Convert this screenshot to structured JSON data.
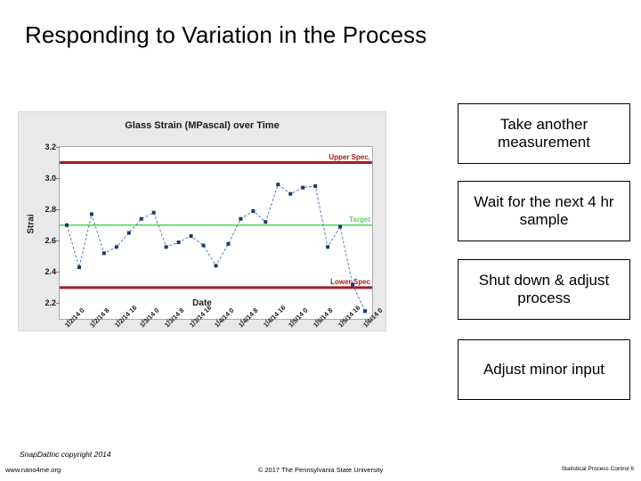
{
  "slide": {
    "title": "Responding to Variation in the Process"
  },
  "chart_data": {
    "type": "line",
    "title": "Glass Strain (MPascal) over Time",
    "xlabel": "Date",
    "ylabel": "Strai",
    "ylim": [
      2.1,
      3.2
    ],
    "yticks": [
      "3.2",
      "3.0",
      "2.8",
      "2.6",
      "2.4",
      "2.2"
    ],
    "ytick_values": [
      3.2,
      3.0,
      2.8,
      2.6,
      2.4,
      2.2
    ],
    "grid": false,
    "legend": "none",
    "marker_color": "#1f3864",
    "line_color": "#4a6fa5",
    "categories": [
      "1/2/14 0",
      "1/2/14 4",
      "1/2/14 8",
      "1/2/14 12",
      "1/2/14 16",
      "1/2/14 20",
      "1/3/14 0",
      "1/3/14 4",
      "1/3/14 8",
      "1/3/14 12",
      "1/3/14 16",
      "1/3/14 20",
      "1/4/14 0",
      "1/4/14 4",
      "1/4/14 8",
      "1/4/14 12",
      "1/4/14 16",
      "1/4/14 20",
      "1/5/14 0",
      "1/5/14 4",
      "1/5/14 8",
      "1/5/14 12",
      "1/5/14 16",
      "1/5/14 20",
      "1/6/14 0"
    ],
    "xtick_labels": [
      "1/2/14 0",
      "1/2/14 8",
      "1/2/14 16",
      "1/3/14 0",
      "1/3/14 8",
      "1/3/14 16",
      "1/4/14 0",
      "1/4/14 8",
      "1/4/14 16",
      "1/5/14 0",
      "1/5/14 8",
      "1/5/14 16",
      "1/6/14 0"
    ],
    "xtick_indices": [
      0,
      2,
      4,
      6,
      8,
      10,
      12,
      14,
      16,
      18,
      20,
      22,
      24
    ],
    "values": [
      2.7,
      2.43,
      2.77,
      2.52,
      2.56,
      2.65,
      2.74,
      2.78,
      2.56,
      2.59,
      2.63,
      2.57,
      2.44,
      2.58,
      2.74,
      2.79,
      2.72,
      2.96,
      2.9,
      2.94,
      2.95,
      2.56,
      2.69,
      2.32,
      2.15
    ],
    "reference_lines": [
      {
        "name": "upper-spec",
        "label": "Upper Spec.",
        "value": 3.1,
        "color": "#a61c1c"
      },
      {
        "name": "target",
        "label": "Target",
        "value": 2.7,
        "color": "#55d45a"
      },
      {
        "name": "lower-spec",
        "label": "Lower Spec",
        "value": 2.3,
        "color": "#a61c1c"
      }
    ]
  },
  "actions": [
    {
      "label": "Take another measurement"
    },
    {
      "label": "Wait for the next 4 hr sample"
    },
    {
      "label": "Shut down & adjust process"
    },
    {
      "label": "Adjust minor input"
    }
  ],
  "footer": {
    "credit": "SnapDatInc copyright 2014",
    "site": "www.nano4me.org",
    "center": "© 2017 The Pennsylvania State University",
    "right": "Statistical Process Control 6"
  }
}
